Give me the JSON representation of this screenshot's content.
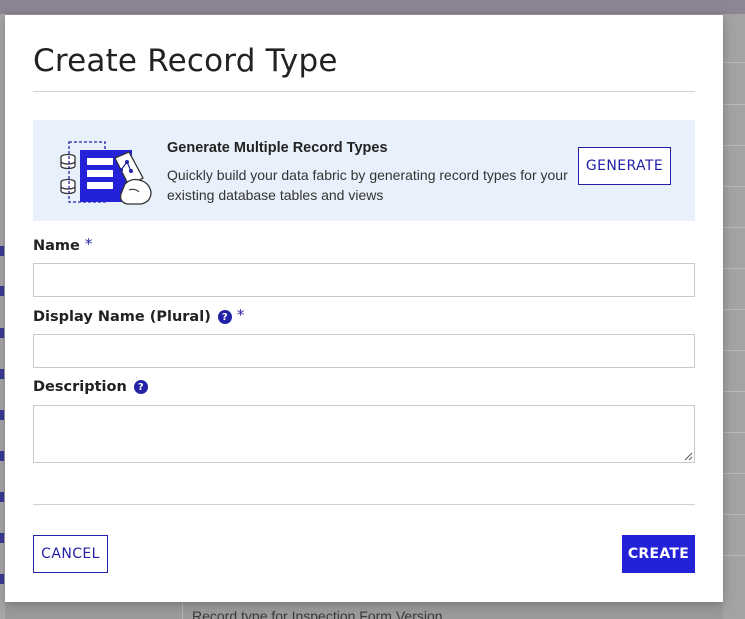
{
  "background": {
    "footer_text": "Record type for Inspection Form Version"
  },
  "dialog": {
    "title": "Create Record Type",
    "banner": {
      "heading": "Generate Multiple Record Types",
      "description": "Quickly build your data fabric by generating record types for your existing database tables and views",
      "button_label": "GENERATE",
      "illustration_icon": "database-table-generate-icon"
    },
    "fields": {
      "name": {
        "label": "Name",
        "required_marker": "*",
        "value": "",
        "placeholder": ""
      },
      "display_name": {
        "label": "Display Name (Plural)",
        "help_glyph": "?",
        "required_marker": "*",
        "value": "",
        "placeholder": ""
      },
      "description": {
        "label": "Description",
        "help_glyph": "?",
        "value": "",
        "placeholder": ""
      }
    },
    "buttons": {
      "cancel": "CANCEL",
      "create": "CREATE"
    }
  },
  "colors": {
    "accent": "#2322a6",
    "primary_button": "#2322d8",
    "banner_bg": "#e8f1fb"
  }
}
